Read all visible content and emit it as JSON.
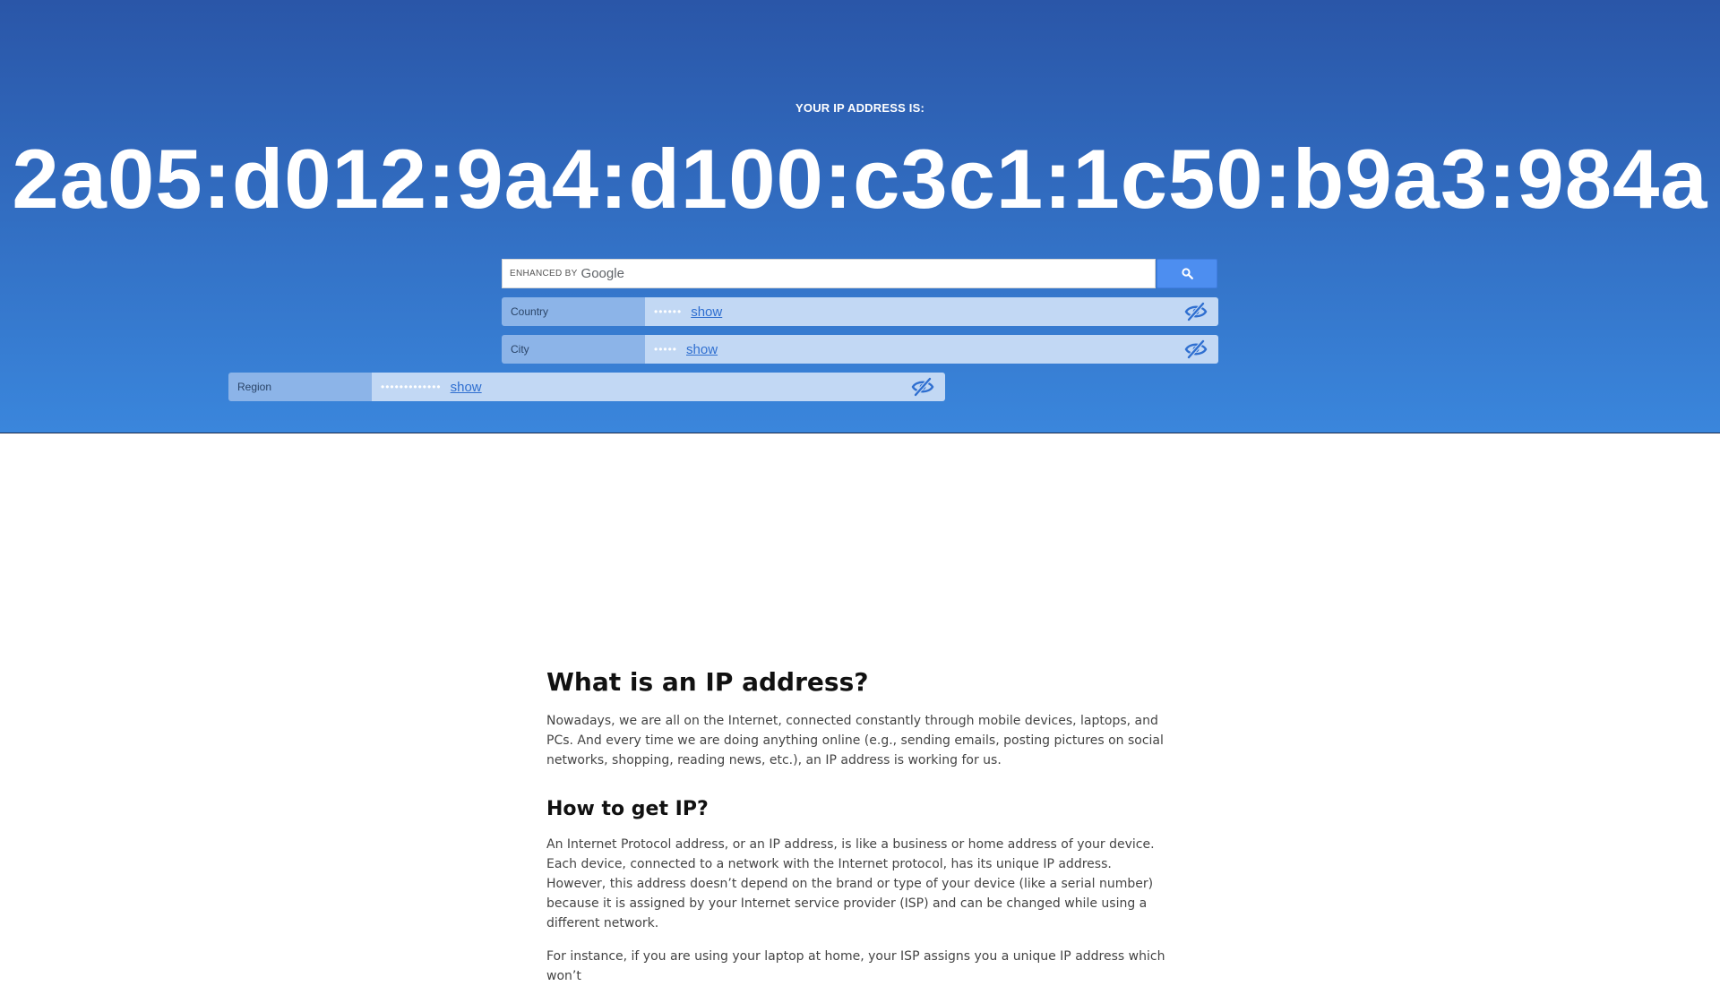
{
  "hero": {
    "label": "YOUR IP ADDRESS IS:",
    "ip": "2a05:d012:9a4:d100:c3c1:1c50:b9a3:984a",
    "background_top": "#2a56a8",
    "background_bottom": "#3a86dc"
  },
  "search": {
    "brand_prefix": "ENHANCED BY",
    "brand_name": "Google",
    "value": "",
    "placeholder": "",
    "button_icon": "search-icon",
    "button_color": "#4d8ef0"
  },
  "info_rows": {
    "country": {
      "label": "Country",
      "masked": "••••••",
      "show_label": "show",
      "icon": "eye-slash-icon"
    },
    "city": {
      "label": "City",
      "masked": "•••••",
      "show_label": "show",
      "icon": "eye-slash-icon"
    },
    "region": {
      "label": "Region",
      "masked": "•••••••••••••",
      "show_label": "show",
      "icon": "eye-slash-icon"
    }
  },
  "article": {
    "heading1": "What is an IP address?",
    "para1": "Nowadays, we are all on the Internet, connected constantly through mobile devices, laptops, and PCs. And every time we are doing anything online (e.g., sending emails, posting pictures on social networks, shopping, reading news, etc.), an IP address is working for us.",
    "heading2": "How to get IP?",
    "para2": "An Internet Protocol address, or an IP address, is like a business or home address of your device. Each device, connected to a network with the Internet protocol, has its unique IP address. However, this address doesn’t depend on the brand or type of your device (like a serial number) because it is assigned by your Internet service provider (ISP) and can be changed while using a different network.",
    "para3": "For instance, if you are using your laptop at home, your ISP assigns you a unique IP address which won’t"
  }
}
